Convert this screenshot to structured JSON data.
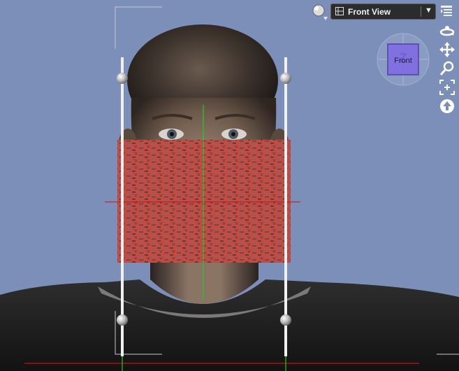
{
  "toolbar": {
    "view_label": "Front View",
    "render_icon": "render-sphere-icon",
    "menu_icon": "viewport-menu-icon"
  },
  "navcube": {
    "face_label": "Front",
    "axis_letter": "Z"
  },
  "nav_tools": [
    "orbit-icon",
    "pan-icon",
    "zoom-icon",
    "frame-icon",
    "aim-icon"
  ],
  "colors": {
    "background": "#7b8fb8",
    "texture_red": "#c44a44",
    "axis_green": "#22cc22",
    "axis_red": "#cc1111",
    "toolbar_bg": "#2c2c2c"
  }
}
